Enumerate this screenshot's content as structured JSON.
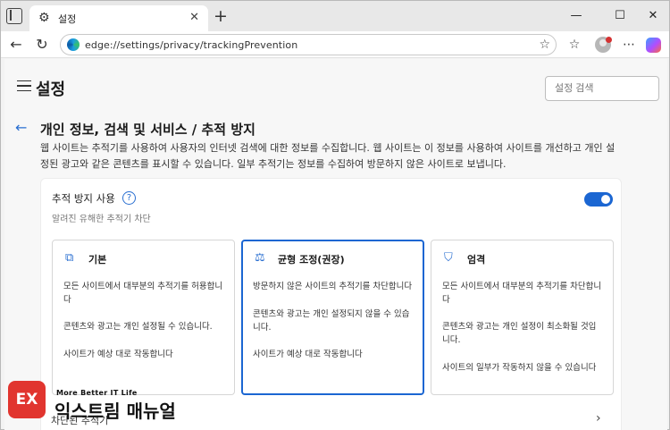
{
  "tab": {
    "title": "설정",
    "icon": "gear-icon"
  },
  "window_controls": {
    "minimize": "—",
    "maximize": "☐",
    "close": "✕"
  },
  "address_bar": {
    "url": "edge://settings/privacy/trackingPrevention"
  },
  "settings": {
    "title": "설정",
    "search_placeholder": "설정 검색"
  },
  "section": {
    "title": "개인 정보, 검색 및 서비스 / 추적 방지",
    "description_line1": "웹 사이트는 추적기를 사용하여 사용자의 인터넷 검색에 대한 정보를 수집합니다. 웹 사이트는 이 정보를 사용하여 사이트를 개선하고 개인 설",
    "description_line2": "정된 광고와 같은 콘텐츠를 표시할 수 있습니다. 일부 추적기는 정보를 수집하여 방문하지 않은 사이트로 보냅니다."
  },
  "tracking_prevention": {
    "label": "추적 방지 사용",
    "help": "?",
    "subtitle": "알려진 유해한 추적기 차단",
    "enabled": true
  },
  "cards": [
    {
      "title": "기본",
      "icon": "shapes-icon",
      "selected": false,
      "lines": [
        "모든 사이트에서 대부분의 추적기를 허용합니다",
        "콘텐츠와 광고는 개인 설정될 수 있습니다.",
        "사이트가 예상 대로 작동합니다"
      ]
    },
    {
      "title": "균형 조정(권장)",
      "icon": "scale-icon",
      "selected": true,
      "lines": [
        "방문하지 않은 사이트의 추적기를 차단합니다",
        "콘텐츠와 광고는 개인 설정되지 않을 수 있습니다.",
        "사이트가 예상 대로 작동합니다"
      ]
    },
    {
      "title": "엄격",
      "icon": "shield-icon",
      "selected": false,
      "lines": [
        "모든 사이트에서 대부분의 추적기를 차단합니다",
        "콘텐츠와 광고는 개인 설정이 최소화될 것입니다.",
        "사이트의 일부가 작동하지 않을 수 있습니다"
      ]
    }
  ],
  "blocked_trackers": {
    "label": "차단된 추적기"
  },
  "watermark": {
    "logo": "EX",
    "tagline": "More Better IT Life",
    "name": "익스트림 매뉴얼"
  }
}
